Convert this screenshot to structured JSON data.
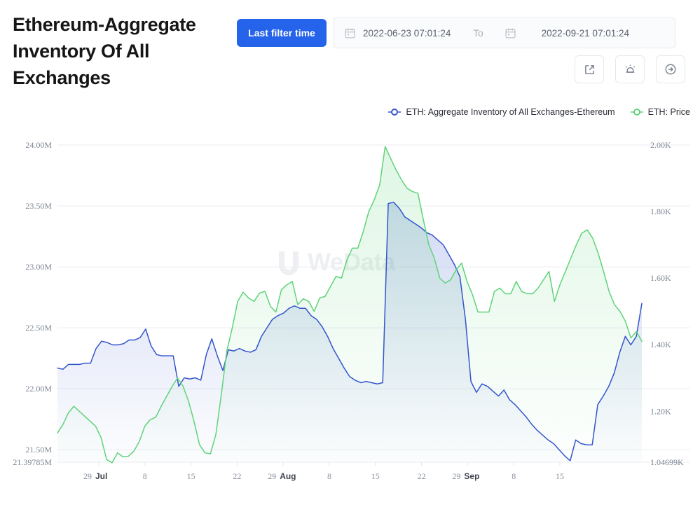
{
  "header": {
    "title": "Ethereum-Aggregate Inventory Of All Exchanges",
    "filter_button": "Last filter time",
    "date_from": "2022-06-23 07:01:24",
    "date_separator": "To",
    "date_to": "2022-09-21 07:01:24",
    "accent_color": "#2563eb",
    "tools": [
      {
        "name": "external-link-icon",
        "title": "Open in new window"
      },
      {
        "name": "alarm-icon",
        "title": "Set alert"
      },
      {
        "name": "arrow-right-circle-icon",
        "title": "Go"
      }
    ]
  },
  "watermark": {
    "text": "WeData",
    "logo": "u-logo-icon"
  },
  "chart_data": {
    "type": "line",
    "title": "Ethereum-Aggregate Inventory Of All Exchanges",
    "legend_position": "top-right",
    "grid": true,
    "xlabel": "",
    "x_tick_labels": [
      "29",
      "Jul",
      "8",
      "15",
      "22",
      "29",
      "Aug",
      "8",
      "15",
      "22",
      "29",
      "Sep",
      "8",
      "15"
    ],
    "x_ticks": [
      {
        "day": "29",
        "month": "Jul"
      },
      {
        "day": "8",
        "month": ""
      },
      {
        "day": "15",
        "month": ""
      },
      {
        "day": "22",
        "month": ""
      },
      {
        "day": "29",
        "month": "Aug"
      },
      {
        "day": "8",
        "month": ""
      },
      {
        "day": "15",
        "month": ""
      },
      {
        "day": "22",
        "month": ""
      },
      {
        "day": "29",
        "month": "Sep"
      },
      {
        "day": "8",
        "month": ""
      },
      {
        "day": "15",
        "month": ""
      }
    ],
    "y_left": {
      "label": "ETH: Aggregate Inventory of All Exchanges-Ethereum",
      "ticks": [
        "24.00M",
        "23.50M",
        "23.00M",
        "22.50M",
        "22.00M",
        "21.50M",
        "21.39785M"
      ],
      "min": 21.39785,
      "max": 24.0,
      "unit": "M"
    },
    "y_right": {
      "label": "ETH: Price",
      "ticks": [
        "2.00K",
        "1.80K",
        "1.60K",
        "1.40K",
        "1.20K",
        "1.04699K"
      ],
      "min": 1.04699,
      "max": 2.0,
      "unit": "K"
    },
    "series": [
      {
        "name": "ETH: Aggregate Inventory of All Exchanges-Ethereum",
        "color": "#3355cc",
        "axis": "left",
        "values": [
          22.17,
          22.16,
          22.2,
          22.2,
          22.2,
          22.21,
          22.21,
          22.33,
          22.39,
          22.38,
          22.36,
          22.36,
          22.37,
          22.4,
          22.4,
          22.42,
          22.49,
          22.35,
          22.28,
          22.27,
          22.27,
          22.27,
          22.02,
          22.09,
          22.08,
          22.09,
          22.07,
          22.28,
          22.41,
          22.27,
          22.15,
          22.32,
          22.31,
          22.33,
          22.31,
          22.3,
          22.32,
          22.43,
          22.5,
          22.57,
          22.6,
          22.62,
          22.66,
          22.68,
          22.66,
          22.66,
          22.6,
          22.57,
          22.51,
          22.43,
          22.33,
          22.25,
          22.17,
          22.1,
          22.07,
          22.05,
          22.06,
          22.05,
          22.04,
          22.05,
          23.52,
          23.53,
          23.48,
          23.41,
          23.38,
          23.35,
          23.32,
          23.28,
          23.26,
          23.22,
          23.18,
          23.1,
          23.02,
          22.92,
          22.57,
          22.06,
          21.97,
          22.04,
          22.02,
          21.98,
          21.94,
          21.99,
          21.91,
          21.87,
          21.82,
          21.77,
          21.71,
          21.66,
          21.62,
          21.58,
          21.55,
          21.5,
          21.45,
          21.41,
          21.58,
          21.55,
          21.54,
          21.54,
          21.87,
          21.94,
          22.02,
          22.13,
          22.3,
          22.43,
          22.36,
          22.43,
          22.7
        ]
      },
      {
        "name": "ETH: Price",
        "color": "#5fd37a",
        "axis": "right",
        "values": [
          1.135,
          1.16,
          1.195,
          1.215,
          1.2,
          1.185,
          1.17,
          1.155,
          1.12,
          1.055,
          1.045,
          1.075,
          1.063,
          1.065,
          1.08,
          1.11,
          1.155,
          1.175,
          1.182,
          1.215,
          1.245,
          1.275,
          1.3,
          1.275,
          1.23,
          1.17,
          1.1,
          1.075,
          1.072,
          1.13,
          1.25,
          1.38,
          1.45,
          1.53,
          1.558,
          1.54,
          1.53,
          1.555,
          1.56,
          1.515,
          1.498,
          1.565,
          1.58,
          1.59,
          1.52,
          1.538,
          1.53,
          1.5,
          1.54,
          1.545,
          1.575,
          1.605,
          1.6,
          1.655,
          1.69,
          1.69,
          1.74,
          1.8,
          1.835,
          1.88,
          1.995,
          1.96,
          1.925,
          1.895,
          1.87,
          1.86,
          1.855,
          1.775,
          1.7,
          1.66,
          1.6,
          1.585,
          1.595,
          1.625,
          1.645,
          1.59,
          1.55,
          1.498,
          1.498,
          1.498,
          1.56,
          1.57,
          1.553,
          1.553,
          1.59,
          1.56,
          1.553,
          1.553,
          1.57,
          1.595,
          1.62,
          1.53,
          1.58,
          1.62,
          1.66,
          1.7,
          1.735,
          1.745,
          1.72,
          1.675,
          1.62,
          1.56,
          1.52,
          1.5,
          1.47,
          1.42,
          1.44,
          1.41
        ]
      }
    ]
  }
}
